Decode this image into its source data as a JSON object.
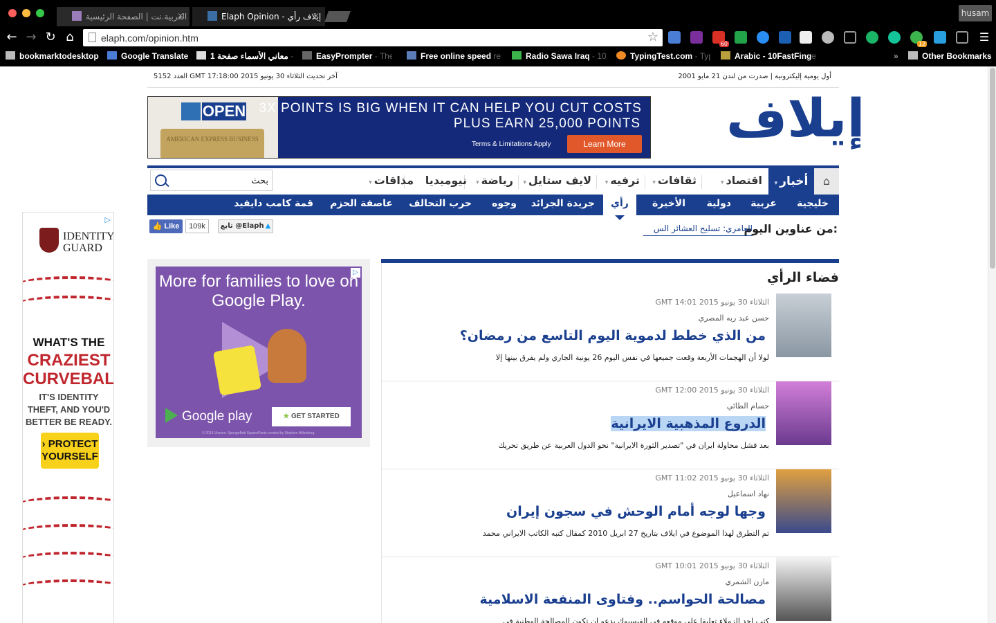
{
  "browser": {
    "tabs": [
      {
        "title": "العربية.نت | الصفحة الرئيسية",
        "active": false
      },
      {
        "title": "Elaph Opinion - إيلاف رأي",
        "active": true
      }
    ],
    "url": "elaph.com/opinion.htm",
    "user": "husam",
    "extension_badges": {
      "gmail": "60",
      "speed": "12"
    },
    "bookmarks": [
      {
        "label": "bookmarktodesktop",
        "extra": ""
      },
      {
        "label": "Google Translate",
        "extra": ""
      },
      {
        "label": "معاني الأسماء صفحة 1",
        "extra": "- ..."
      },
      {
        "label": "EasyPrompter",
        "extra": "- The"
      },
      {
        "label": "Free online speed",
        "extra": "re"
      },
      {
        "label": "Radio Sawa Iraq",
        "extra": "- 10"
      },
      {
        "label": "TypingTest.com",
        "extra": "- Typ"
      },
      {
        "label": "Arabic - 10FastFing",
        "extra": "e"
      }
    ],
    "overflow": "»",
    "other_bookmarks": "Other Bookmarks"
  },
  "header": {
    "update_line": "آخر تحديث الثلاثاء 30 يونيو 2015 GMT 17:18:00",
    "issue": "العدد 5152",
    "tagline": "أول يومية إليكترونية | صدرت من لندن 21 مايو 2001",
    "logo": "إيلاف"
  },
  "banner_ad": {
    "brand": "OPEN",
    "card_text": "AMERICAN EXPRESS BUSINESS",
    "line1": "3X POINTS IS BIG WHEN IT CAN HELP YOU CUT COSTS",
    "line2": "PLUS EARN 25,000 POINTS",
    "terms": "Terms & Limitations Apply",
    "cta": "Learn More"
  },
  "nav_main": {
    "home": "⌂",
    "items": [
      "أخبار",
      "اقتصاد",
      "ثقافات",
      "ترفيه",
      "لايف ستايل",
      "رياضة",
      "نيوميديا",
      "مذاقات"
    ],
    "search_value": "بحث"
  },
  "nav_sub": {
    "items": [
      "خليجية",
      "عربية",
      "دولية",
      "الأخيرة",
      "رأي",
      "جريدة الجرائد",
      "وجوه",
      "حرب التحالف",
      "عاصفة الحزم",
      "قمة كامب دايفيد"
    ],
    "active": "رأي"
  },
  "ticker": {
    "label": "من عناوين اليوم:",
    "headline": "العامري: تسليح العشائر الس"
  },
  "social": {
    "like_label": "Like",
    "like_count": "109k",
    "follow_label": "تابع @Elaph"
  },
  "side_ad": {
    "brand_line1": "IDENTITY",
    "brand_line2": "GUARD",
    "q1": "WHAT'S THE",
    "q2": "CRAZIEST CURVEBALL?",
    "q3": "IT'S IDENTITY THEFT, AND YOU'D BETTER BE READY.",
    "cta": "› PROTECT YOURSELF"
  },
  "google_play_ad": {
    "title": "More for families to love on Google Play.",
    "logo": "Google play",
    "cta": "GET STARTED",
    "fine_print": "© 2015 Viacom. SpongeBob SquarePants created by Stephen Hillenburg."
  },
  "opinion": {
    "title": "فضاء الرأي",
    "articles": [
      {
        "date": "الثلاثاء 30 يونيو 2015 GMT 14:01",
        "author": "حسن عبد ربه المصري",
        "headline": "من الذي خطط لدموية اليوم التاسع من رمضان؟",
        "summary": "لولا أن الهجمات الأربعة وقعت جميعها في نفس اليوم 26 يونية الجاري ولم يفرق بينها إلا",
        "selected": false
      },
      {
        "date": "الثلاثاء 30 يونيو 2015 GMT 12:00",
        "author": "حسام الطائي",
        "headline": "الدروع المذهبية الايرانية",
        "summary": "بعد فشل محاولة ايران في \"تصدير الثورة الايرانية\" نحو الدول العربية عن طريق تحريك",
        "selected": true
      },
      {
        "date": "الثلاثاء 30 يونيو 2015 GMT 11:02",
        "author": "نهاد اسماعيل",
        "headline": "وجها لوجه أمام الوحش في سجون إيران",
        "summary": "تم التطرق لهذا الموضوع في ايلاف بتاريخ 27 ابريل 2010 كمقال كتبه الكاتب الايراني محمد",
        "selected": false
      },
      {
        "date": "الثلاثاء 30 يونيو 2015 GMT 10:01",
        "author": "مازن الشمري",
        "headline": "مصالحة الحواسم.. وفتاوى المنفعة الاسلامية",
        "summary": "كتب احد الزملاء تعليقا على موقعه في الفيسبوك يدعو ان تكون المصالحة الوطنية في",
        "selected": false
      }
    ]
  },
  "colors": {
    "brand": "#1a3f8f",
    "selection": "#b9d6f4"
  }
}
